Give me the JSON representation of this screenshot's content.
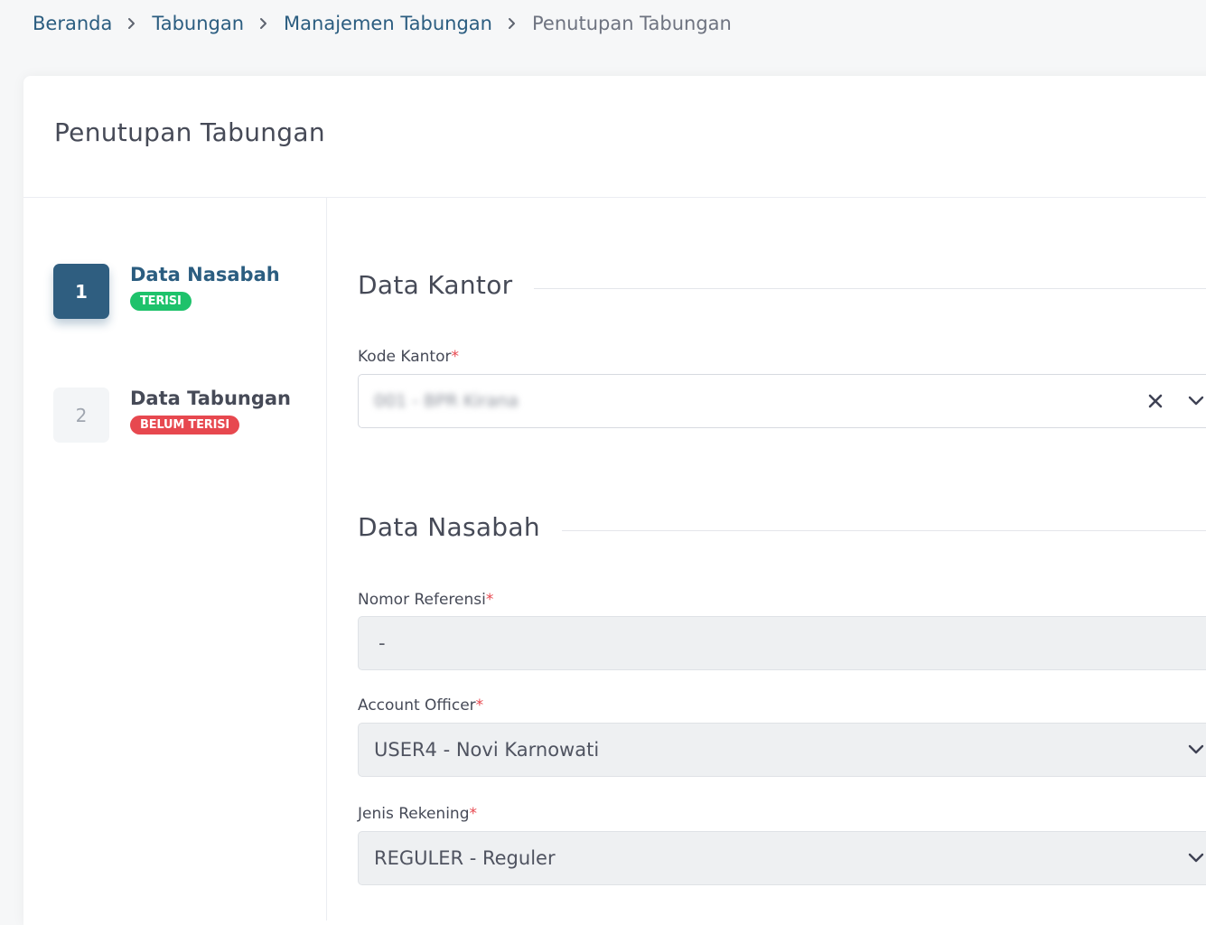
{
  "breadcrumb": {
    "items": [
      "Beranda",
      "Tabungan",
      "Manajemen Tabungan"
    ],
    "current": "Penutupan Tabungan"
  },
  "card": {
    "title": "Penutupan Tabungan"
  },
  "steps": [
    {
      "number": "1",
      "label": "Data Nasabah",
      "badge": "TERISI",
      "state": "active"
    },
    {
      "number": "2",
      "label": "Data Tabungan",
      "badge": "BELUM TERISI",
      "state": "inactive"
    }
  ],
  "sections": {
    "kantor_title": "Data Kantor",
    "nasabah_title": "Data Nasabah"
  },
  "fields": {
    "kode_kantor": {
      "label": "Kode Kantor",
      "required": "*",
      "value": "001 - BPR Kirana"
    },
    "nomor_referensi": {
      "label": "Nomor Referensi",
      "required": "*",
      "value": "-"
    },
    "account_officer": {
      "label": "Account Officer",
      "required": "*",
      "value": "USER4 - Novi Karnowati"
    },
    "jenis_rekening": {
      "label": "Jenis Rekening",
      "required": "*",
      "value": "REGULER - Reguler"
    }
  },
  "colors": {
    "primary": "#2f5e80",
    "success_badge": "#1ec26b",
    "danger_badge": "#e7484f",
    "required_mark": "#e7484f"
  },
  "icons": {
    "breadcrumb_separator": "chevron-right-icon",
    "clear": "close-icon",
    "dropdown": "chevron-down-icon"
  }
}
